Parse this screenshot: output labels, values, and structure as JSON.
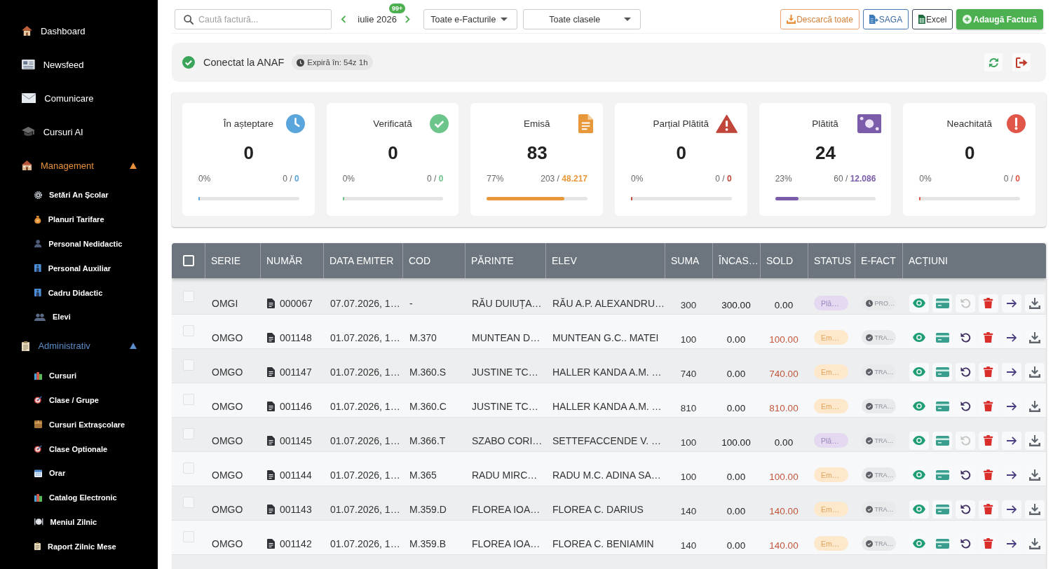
{
  "sidebar": {
    "items": [
      {
        "kind": "link",
        "label": "Dashboard",
        "selected": false
      },
      {
        "kind": "link",
        "label": "Newsfeed",
        "selected": false
      },
      {
        "kind": "link",
        "label": "Comunicare",
        "selected": false
      },
      {
        "kind": "link",
        "label": "Cursuri AI",
        "selected": false
      },
      {
        "kind": "group",
        "label": "Management",
        "selected": false,
        "expanded": true,
        "color": "#e8913a",
        "children": [
          {
            "label": "Setări An Școlar",
            "selected": false
          },
          {
            "label": "Planuri Tarifare",
            "selected": false
          },
          {
            "label": "Personal Nedidactic",
            "selected": false
          },
          {
            "label": "Personal Auxiliar",
            "selected": false
          },
          {
            "label": "Cadru Didactic",
            "selected": false
          },
          {
            "label": "Elevi",
            "selected": false
          }
        ]
      },
      {
        "kind": "group",
        "label": "Administrativ",
        "selected": false,
        "expanded": true,
        "color": "#5b8dc9",
        "children": [
          {
            "label": "Cursuri",
            "selected": false
          },
          {
            "label": "Clase / Grupe",
            "selected": false
          },
          {
            "label": "Cursuri Extrașcolare",
            "selected": false
          },
          {
            "label": "Clase Optionale",
            "selected": false
          },
          {
            "label": "Orar",
            "selected": false
          },
          {
            "label": "Catalog Electronic",
            "selected": false
          },
          {
            "label": "Meniul Zilnic",
            "selected": false
          },
          {
            "label": "Raport Zilnic Mese",
            "selected": false
          }
        ]
      }
    ]
  },
  "toolbar": {
    "search": {
      "placeholder": "Caută factură..."
    },
    "month": {
      "label": "iulie 2026",
      "badge": "99+"
    },
    "filters": [
      {
        "value": "Toate e-Facturile"
      },
      {
        "value": "Toate clasele"
      }
    ],
    "buttons": [
      {
        "kind": "download",
        "label": "Descarcă toate"
      },
      {
        "kind": "export",
        "label": "SAGA"
      },
      {
        "kind": "excel",
        "label": "Excel"
      },
      {
        "kind": "add",
        "label": "Adaugă Factură"
      }
    ]
  },
  "anaf": {
    "connected": true,
    "label": "Conectat la ANAF",
    "expiry": "Expiră în: 54z 1h"
  },
  "stats": [
    {
      "kind": "pending",
      "label": "În așteptare",
      "value": "0",
      "percent": "0%",
      "totals": "0 / **0**",
      "level": 0,
      "color": "#5aa5db"
    },
    {
      "kind": "verified",
      "label": "Verificată",
      "value": "0",
      "percent": "0%",
      "totals": "0 / **0**",
      "level": 0,
      "color": "#6cc58a"
    },
    {
      "kind": "issued",
      "label": "Emisă",
      "value": "83",
      "percent": "77%",
      "totals": "203 / **48.217**",
      "level": 0.77,
      "color": "#e8983a"
    },
    {
      "kind": "partial",
      "label": "Parțial Plătită",
      "value": "0",
      "percent": "0%",
      "totals": "0 / **0**",
      "level": 0,
      "color": "#c0453a"
    },
    {
      "kind": "paid",
      "label": "Plătită",
      "value": "24",
      "percent": "23%",
      "totals": "60 / **12.086**",
      "level": 0.23,
      "color": "#7a5cab"
    },
    {
      "kind": "unpaid",
      "label": "Neachitată",
      "value": "0",
      "percent": "0%",
      "totals": "0 / **0**",
      "level": 0,
      "color": "#e0574a"
    }
  ],
  "table": {
    "select_all": {
      "checked": false
    },
    "columns": [
      "SERIE",
      "NUMĂR",
      "DATA EMITER",
      "COD",
      "PĂRINTE",
      "ELEV",
      "SUMA",
      "ÎNCAS…",
      "SOLD",
      "STATUS",
      "E-FACT",
      "ACȚIUNI"
    ],
    "rows": [
      {
        "selected": false,
        "serie": "OMGI",
        "numar": "000067",
        "data": "07.07.2026, 1…",
        "cod": "-",
        "parinte": "RĂU DUIUȚA…",
        "elev": "RĂU A.P. ALEXANDRU…",
        "suma": "300",
        "incasat": "300.00",
        "sold": "0.00",
        "outstanding": false,
        "status": {
          "kind": "paid",
          "label": "Plă…"
        },
        "efact": {
          "kind": "processing",
          "label": "PRO…"
        },
        "undo_disabled": true
      },
      {
        "selected": false,
        "serie": "OMGO",
        "numar": "001148",
        "data": "01.07.2026, 1…",
        "cod": "M.370",
        "parinte": "MUNTEAN D…",
        "elev": "MUNTEAN G.C.. MATEI",
        "suma": "100",
        "incasat": "0.00",
        "sold": "100.00",
        "outstanding": true,
        "status": {
          "kind": "issued",
          "label": "Em…"
        },
        "efact": {
          "kind": "transmitted",
          "label": "TRA…"
        },
        "undo_disabled": false
      },
      {
        "selected": false,
        "serie": "OMGO",
        "numar": "001147",
        "data": "01.07.2026, 1…",
        "cod": "M.360.S",
        "parinte": "JUSTINE TC…",
        "elev": "HALLER KANDA A.M. …",
        "suma": "740",
        "incasat": "0.00",
        "sold": "740.00",
        "outstanding": true,
        "status": {
          "kind": "issued",
          "label": "Em…"
        },
        "efact": {
          "kind": "transmitted",
          "label": "TRA…"
        },
        "undo_disabled": false
      },
      {
        "selected": false,
        "serie": "OMGO",
        "numar": "001146",
        "data": "01.07.2026, 1…",
        "cod": "M.360.C",
        "parinte": "JUSTINE TC…",
        "elev": "HALLER KANDA A.M. …",
        "suma": "810",
        "incasat": "0.00",
        "sold": "810.00",
        "outstanding": true,
        "status": {
          "kind": "issued",
          "label": "Em…"
        },
        "efact": {
          "kind": "transmitted",
          "label": "TRA…"
        },
        "undo_disabled": false
      },
      {
        "selected": false,
        "serie": "OMGO",
        "numar": "001145",
        "data": "01.07.2026, 1…",
        "cod": "M.366.T",
        "parinte": "SZABO CORI…",
        "elev": "SETTEFACCENDE V. …",
        "suma": "100",
        "incasat": "100.00",
        "sold": "0.00",
        "outstanding": false,
        "status": {
          "kind": "paid",
          "label": "Plă…"
        },
        "efact": {
          "kind": "transmitted",
          "label": "TRA…"
        },
        "undo_disabled": true
      },
      {
        "selected": false,
        "serie": "OMGO",
        "numar": "001144",
        "data": "01.07.2026, 1…",
        "cod": "M.365",
        "parinte": "RADU MIRC…",
        "elev": "RADU M.C. ADINA SA…",
        "suma": "100",
        "incasat": "0.00",
        "sold": "100.00",
        "outstanding": true,
        "status": {
          "kind": "issued",
          "label": "Em…"
        },
        "efact": {
          "kind": "transmitted",
          "label": "TRA…"
        },
        "undo_disabled": false
      },
      {
        "selected": false,
        "serie": "OMGO",
        "numar": "001143",
        "data": "01.07.2026, 1…",
        "cod": "M.359.D",
        "parinte": "FLOREA IOA…",
        "elev": "FLOREA C. DARIUS",
        "suma": "140",
        "incasat": "0.00",
        "sold": "140.00",
        "outstanding": true,
        "status": {
          "kind": "issued",
          "label": "Em…"
        },
        "efact": {
          "kind": "transmitted",
          "label": "TRA…"
        },
        "undo_disabled": false
      },
      {
        "selected": false,
        "serie": "OMGO",
        "numar": "001142",
        "data": "01.07.2026, 1…",
        "cod": "M.359.B",
        "parinte": "FLOREA IOA…",
        "elev": "FLOREA C. BENIAMIN",
        "suma": "140",
        "incasat": "0.00",
        "sold": "140.00",
        "outstanding": true,
        "status": {
          "kind": "issued",
          "label": "Em…"
        },
        "efact": {
          "kind": "transmitted",
          "label": "TRA…"
        },
        "undo_disabled": false
      }
    ]
  }
}
